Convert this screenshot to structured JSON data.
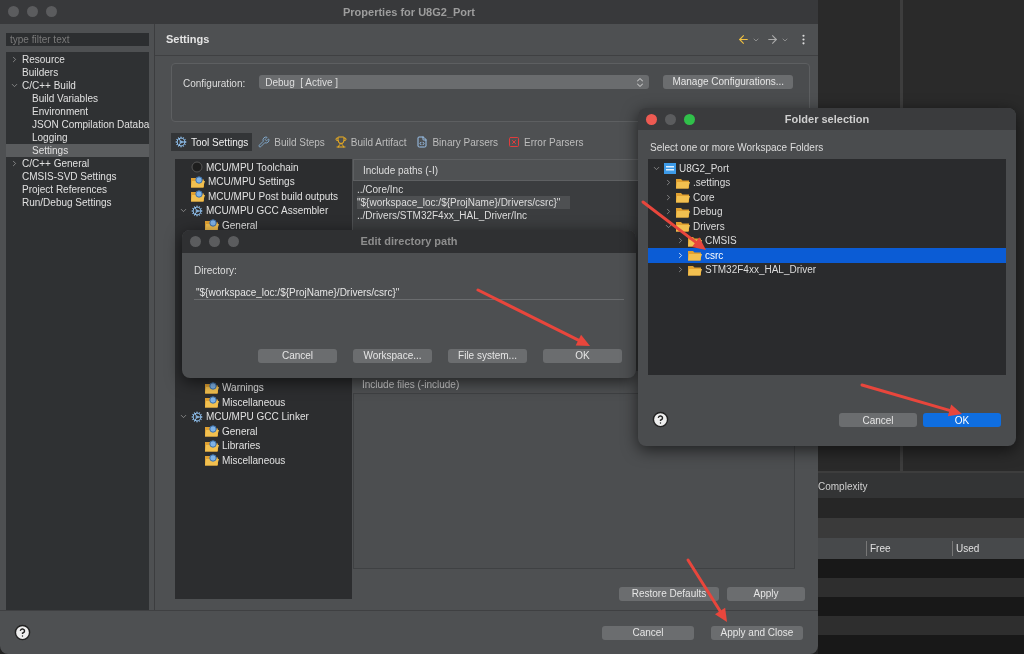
{
  "main_window": {
    "title": "Properties for U8G2_Port",
    "filter": {
      "placeholder": "type filter text"
    },
    "nav": [
      {
        "label": "Resource",
        "expanded": false,
        "selected": false
      },
      {
        "label": "Builders",
        "selected": false
      },
      {
        "label": "C/C++ Build",
        "expanded": true,
        "selected": false,
        "children": [
          {
            "label": "Build Variables",
            "selected": false
          },
          {
            "label": "Environment",
            "selected": false
          },
          {
            "label": "JSON Compilation Databa",
            "selected": false
          },
          {
            "label": "Logging",
            "selected": false
          },
          {
            "label": "Settings",
            "selected": true
          }
        ]
      },
      {
        "label": "C/C++ General",
        "expanded": false,
        "selected": false
      },
      {
        "label": "CMSIS-SVD Settings",
        "selected": false
      },
      {
        "label": "Project References",
        "selected": false
      },
      {
        "label": "Run/Debug Settings",
        "selected": false
      }
    ],
    "page_title": "Settings",
    "configuration": {
      "label": "Configuration:",
      "value": "Debug  [ Active ]",
      "button": "Manage Configurations..."
    },
    "tabs": [
      {
        "label": "Tool Settings",
        "selected": true
      },
      {
        "label": "Build Steps",
        "selected": false
      },
      {
        "label": "Build Artifact",
        "selected": false
      },
      {
        "label": "Binary Parsers",
        "selected": false
      },
      {
        "label": "Error Parsers",
        "selected": false
      }
    ],
    "tool_tree": {
      "items": [
        {
          "label": "MCU/MPU Toolchain",
          "kind": "toolchain"
        },
        {
          "label": "MCU/MPU Settings",
          "kind": "option"
        },
        {
          "label": "MCU/MPU Post build outputs",
          "kind": "option"
        },
        {
          "label": "MCU/MPU GCC Assembler",
          "kind": "tool",
          "expanded": true,
          "children": [
            {
              "label": "General",
              "kind": "option"
            }
          ]
        }
      ],
      "after_hidden": {
        "children": [
          {
            "label": "Warnings",
            "kind": "option"
          },
          {
            "label": "Miscellaneous",
            "kind": "option"
          }
        ],
        "items": [
          {
            "label": "MCU/MPU GCC Linker",
            "kind": "tool",
            "expanded": true,
            "children": [
              {
                "label": "General",
                "kind": "option"
              },
              {
                "label": "Libraries",
                "kind": "option"
              },
              {
                "label": "Miscellaneous",
                "kind": "option"
              }
            ]
          }
        ]
      }
    },
    "include_paths": {
      "title": "Include paths (-I)",
      "items": [
        {
          "text": "../Core/Inc",
          "selected": false
        },
        {
          "text": "\"${workspace_loc:/${ProjName}/Drivers/csrc}\"",
          "selected": true
        },
        {
          "text": "../Drivers/STM32F4xx_HAL_Driver/Inc",
          "selected": false
        }
      ]
    },
    "include_files": {
      "title": "Include files (-include)"
    },
    "buttons": [
      "Restore Defaults",
      "Apply"
    ],
    "footer_buttons": [
      "Cancel",
      "Apply and Close"
    ]
  },
  "edit_dialog": {
    "title": "Edit directory path",
    "label": "Directory:",
    "value": "\"${workspace_loc:/${ProjName}/Drivers/csrc}\"",
    "buttons": [
      "Cancel",
      "Workspace...",
      "File system...",
      "OK"
    ]
  },
  "folder_dialog": {
    "title": "Folder selection",
    "prompt": "Select one or more Workspace Folders",
    "tree": [
      {
        "label": "U8G2_Port",
        "kind": "project",
        "expanded": true,
        "selected": false,
        "children": [
          {
            "label": ".settings",
            "kind": "folder",
            "expanded": false,
            "selected": false
          },
          {
            "label": "Core",
            "kind": "folder",
            "expanded": false,
            "selected": false
          },
          {
            "label": "Debug",
            "kind": "folder",
            "expanded": false,
            "selected": false
          },
          {
            "label": "Drivers",
            "kind": "folder",
            "expanded": true,
            "selected": false,
            "children": [
              {
                "label": "CMSIS",
                "kind": "folder",
                "expanded": false,
                "selected": false
              },
              {
                "label": "csrc",
                "kind": "folder",
                "expanded": false,
                "selected": true
              },
              {
                "label": "STM32F4xx_HAL_Driver",
                "kind": "folder",
                "expanded": false,
                "selected": false
              }
            ]
          }
        ]
      }
    ],
    "buttons": [
      {
        "label": "Cancel",
        "default": false
      },
      {
        "label": "OK",
        "default": true
      }
    ]
  },
  "background": {
    "tab": "Complexity",
    "columns": [
      "Free",
      "Used"
    ]
  }
}
